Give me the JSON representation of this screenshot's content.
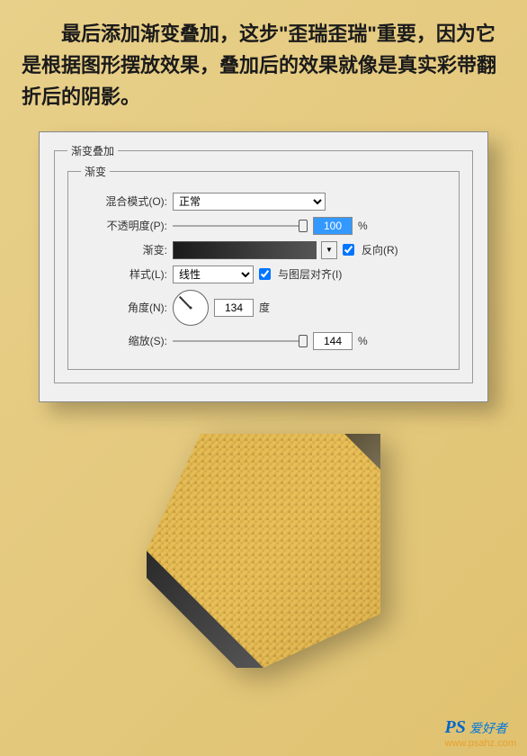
{
  "intro_text": "最后添加渐变叠加，这步\"歪瑞歪瑞\"重要，因为它是根据图形摆放效果，叠加后的效果就像是真实彩带翻折后的阴影。",
  "panel": {
    "outer_legend": "渐变叠加",
    "inner_legend": "渐变",
    "blend_mode": {
      "label": "混合模式(O):",
      "value": "正常"
    },
    "opacity": {
      "label": "不透明度(P):",
      "value": "100",
      "unit": "%"
    },
    "gradient": {
      "label": "渐变:",
      "reverse_label": "反向(R)"
    },
    "style": {
      "label": "样式(L):",
      "value": "线性",
      "align_label": "与图层对齐(I)"
    },
    "angle": {
      "label": "角度(N):",
      "value": "134",
      "unit": "度"
    },
    "scale": {
      "label": "缩放(S):",
      "value": "144",
      "unit": "%"
    }
  },
  "watermark": {
    "ps": "PS",
    "cn": "爱好者",
    "url": "www.psahz.com"
  }
}
